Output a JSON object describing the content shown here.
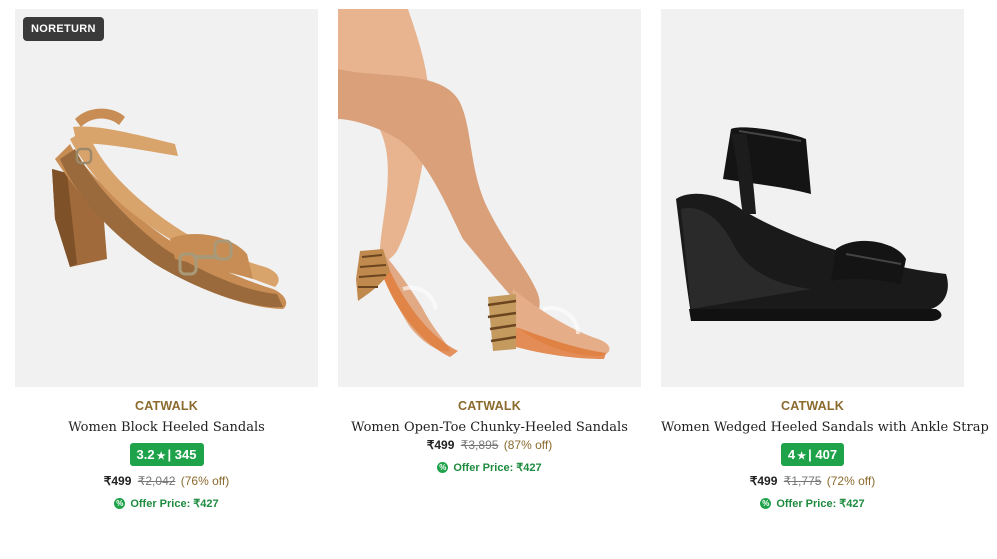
{
  "products": [
    {
      "badge": "NORETURN",
      "brand": "CATWALK",
      "name": "Women Block Heeled Sandals",
      "rating": "3.2",
      "star": "★",
      "rating_count": "| 345",
      "price": "₹499",
      "mrp": "₹2,042",
      "discount": "(76% off)",
      "offer_label": "Offer Price: ₹427",
      "image_subject": "tan-block-heel-sandal"
    },
    {
      "brand": "CATWALK",
      "name": "Women Open-Toe Chunky-Heeled Sandals",
      "price": "₹499",
      "mrp": "₹3,895",
      "discount": "(87% off)",
      "offer_label": "Offer Price: ₹427",
      "image_subject": "model-legs-clear-chunky-heels"
    },
    {
      "brand": "CATWALK",
      "name": "Women Wedged Heeled Sandals with Ankle Strap",
      "rating": "4",
      "star": "★",
      "rating_count": "| 407",
      "price": "₹499",
      "mrp": "₹1,775",
      "discount": "(72% off)",
      "offer_label": "Offer Price: ₹427",
      "image_subject": "black-wedge-sandal"
    }
  ],
  "colors": {
    "brand": "#8b6a2d",
    "rating_bg": "#1fa34a",
    "offer": "#1e8b3f",
    "image_bg": "#f1f1f1"
  }
}
